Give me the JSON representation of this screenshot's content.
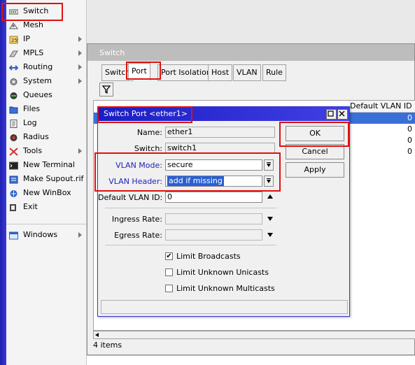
{
  "menu": {
    "items": [
      {
        "label": "Switch",
        "icon": "switch-icon",
        "arrow": false
      },
      {
        "label": "Mesh",
        "icon": "mesh-icon",
        "arrow": false
      },
      {
        "label": "IP",
        "icon": "ip-icon",
        "arrow": true
      },
      {
        "label": "MPLS",
        "icon": "mpls-icon",
        "arrow": true
      },
      {
        "label": "Routing",
        "icon": "routing-icon",
        "arrow": true
      },
      {
        "label": "System",
        "icon": "system-icon",
        "arrow": true
      },
      {
        "label": "Queues",
        "icon": "queues-icon",
        "arrow": false
      },
      {
        "label": "Files",
        "icon": "files-icon",
        "arrow": false
      },
      {
        "label": "Log",
        "icon": "log-icon",
        "arrow": false
      },
      {
        "label": "Radius",
        "icon": "radius-icon",
        "arrow": false
      },
      {
        "label": "Tools",
        "icon": "tools-icon",
        "arrow": true
      },
      {
        "label": "New Terminal",
        "icon": "terminal-icon",
        "arrow": false
      },
      {
        "label": "Make Supout.rif",
        "icon": "supout-icon",
        "arrow": false
      },
      {
        "label": "New WinBox",
        "icon": "winbox-icon",
        "arrow": false
      },
      {
        "label": "Exit",
        "icon": "exit-icon",
        "arrow": false
      }
    ],
    "windows_label": "Windows"
  },
  "switch_window": {
    "title": "Switch",
    "tabs": [
      "Switch",
      "Port",
      "Port Isolation",
      "Host",
      "VLAN",
      "Rule"
    ],
    "active_tab": "Port",
    "columns": [
      "Default VLAN ID"
    ],
    "rows": [
      "0",
      "0",
      "0",
      "0"
    ],
    "status": "4 items"
  },
  "dialog": {
    "title": "Switch Port <ether1>",
    "fields": {
      "name": {
        "label": "Name:",
        "value": "ether1"
      },
      "switch": {
        "label": "Switch:",
        "value": "switch1"
      },
      "vlan_mode": {
        "label": "VLAN Mode:",
        "value": "secure"
      },
      "vlan_header": {
        "label": "VLAN Header:",
        "value": "add if missing"
      },
      "default_vlan_id": {
        "label": "Default VLAN ID:",
        "value": "0"
      },
      "ingress_rate": {
        "label": "Ingress Rate:",
        "value": ""
      },
      "egress_rate": {
        "label": "Egress Rate:",
        "value": ""
      }
    },
    "checkboxes": [
      {
        "label": "Limit Broadcasts",
        "checked": true
      },
      {
        "label": "Limit Unknown Unicasts",
        "checked": false
      },
      {
        "label": "Limit Unknown Multicasts",
        "checked": false
      }
    ],
    "buttons": {
      "ok": "OK",
      "cancel": "Cancel",
      "apply": "Apply"
    }
  },
  "colors": {
    "annotation_red": "#e01010",
    "title_blue": "#2020c0",
    "selection_blue": "#2a5fd4"
  }
}
